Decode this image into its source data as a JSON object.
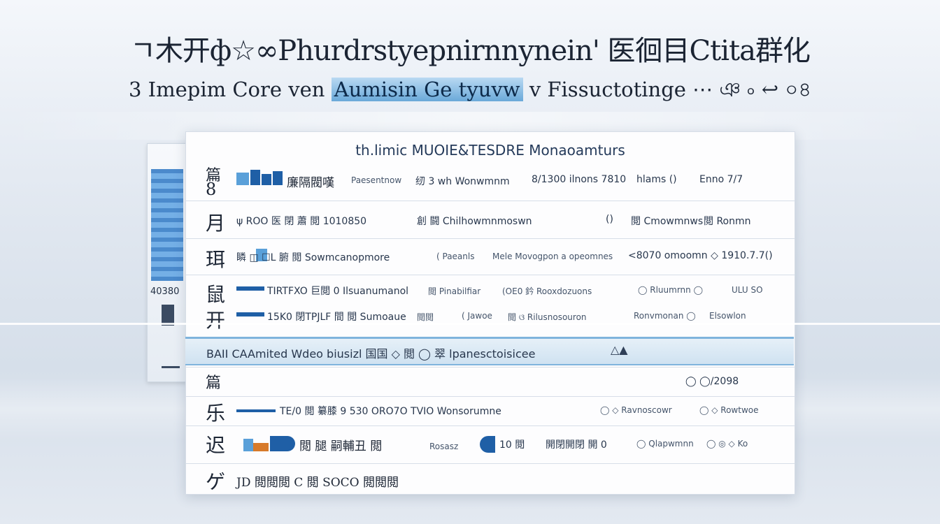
{
  "header": {
    "title": "ㄱ木开ф☆∞Phurdrstyepnirnnynein' 医徊目Ctita群化",
    "subtitle_prefix": "3 Imepim Core ven",
    "subtitle_highlight": "Aumisin Ge tyuvw",
    "subtitle_suffix": "v Fissuctotinge ⋯ ঞ ৹ ↩ ০৪"
  },
  "side_thumb": {
    "number": "40380"
  },
  "panel": {
    "title": "th.limic MUOIE&TESDRE Monaoamturs",
    "rows": [
      {
        "icon": "篇",
        "icon2": "8",
        "c1": "廉隔閥嘆",
        "c2": "Paesentnow",
        "c3": "纫 3 wh Wonwmnm",
        "c4": "8/1300 ilnons 7810",
        "c5": "hlams  ()",
        "c6": "Enno 7/7"
      },
      {
        "icon": "月",
        "c1": "ψ ROO 医 閉 蕭 閲 1010850",
        "c2": "創 闘 Chilhowmnmoswn",
        "c3": "()",
        "c4": "閲 Cmowmnws",
        "c5": "閲 Ronmn"
      },
      {
        "icon": "珥",
        "c1": "瞵 ◫ ☐L 腑 閲 Sowmcanopmore",
        "c2": "( Paeanls",
        "c3": "Mele Movogpon a opeomnes",
        "c4": "<8070 omoomn ◇ 1910.7.7()"
      },
      {
        "icon": "鼠",
        "c1": "TIRTFXO 巨閲 0 Ilsuanumanol",
        "c2": "閲 Pinabilfiar",
        "c3": "(OE0 鈐 Rooxdozuons",
        "c4": "◯ Rluumrnn ◯",
        "c5": "ULU SO"
      },
      {
        "icon": "开",
        "c1": "15K0 閉TPJLF 間 閲 Sumoaue",
        "c2": "閲閲",
        "c3": "( Jawoe",
        "c4": "閲 ଓ Rilusnosouron",
        "c5": "Ronvmonan ◯",
        "c6": "Elsowlon"
      },
      {
        "icon": "篇",
        "c1": "◯ ◯/2098"
      },
      {
        "icon": "乐",
        "c1": "TE/0 閲 纂膝 9 530 ORO7O TVIO Wonsorumne",
        "c2": "◯ ◇ Ravnoscowr",
        "c3": "◯ ◇ Rowtwoe"
      },
      {
        "icon": "迟",
        "c1": "閲 腿 嗣輔丑 閲",
        "c2": "Rosasz",
        "c3": "10 閲",
        "c4": "開閉開閉 開 0",
        "c5": "◯ Qlapwmnn",
        "c6": "◯ ◎ ◇ Ko"
      },
      {
        "icon": "ゲ",
        "c1": "JD 閲閲閲 C 閲 SOCO 閲閲閲"
      }
    ]
  },
  "strip": {
    "text": "BAII CAAmited Wdeo biusizl 国国 ◇ 閲 ◯ 翠 lpanesctoisicee",
    "tail": "△▲"
  },
  "colors": {
    "accent": "#1f5fa6",
    "accent_light": "#5aa0d9",
    "orange": "#d77a2a"
  }
}
